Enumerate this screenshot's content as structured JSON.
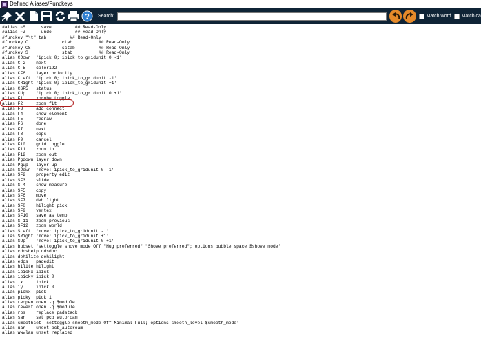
{
  "window": {
    "title": "Defined Aliases/Funckeys"
  },
  "toolbar": {
    "icons": [
      "pin-icon",
      "close-icon",
      "new-file-icon",
      "save-icon",
      "refresh-icon",
      "print-icon",
      "help-icon"
    ],
    "search_label": "Search:",
    "search_value": "",
    "match_word_label": "Match word",
    "match_case_label": "Match ca"
  },
  "colors": {
    "toolbar_bg": "#0f2436",
    "nav_btn": "#e58a2a",
    "highlight_ring": "#b01c1c"
  },
  "lines": [
    "#alias ~S      save         ## Read-Only",
    "#alias ~Z      undo         ## Read-Only",
    "#funckey \"\\t\" tab         ## Read-Only",
    "#funckey C             ctab          ## Read-Only",
    "#funckey CS            sctab         ## Read-Only",
    "#funckey S             stab          ## Read-Only",
    "alias CDown  'ipick 0; ipick_to_gridunit 0 -1'",
    "alias CF2    next",
    "alias CF5    color192",
    "alias CF6    layer priority",
    "alias CLeft  'ipick 0; ipick_to_gridunit -1'",
    "alias CRight 'ipick 0; ipick_to_gridunit +1'",
    "alias CSF5   status",
    "alias CUp    'ipick 0; ipick_to_gridunit 0 +1'",
    "alias F1     xprobe toggle",
    "alias F2     zoom fit",
    "alias F3     add connect",
    "alias F4     show element",
    "alias F5     redraw",
    "alias F6     done",
    "alias F7     next",
    "alias F8     oops",
    "alias F9     cancel",
    "alias F10    grid toggle",
    "alias F11    zoom in",
    "alias F12    zoom out",
    "alias Pgdown layer down",
    "alias Pgup   layer up",
    "alias SDown  'move; ipick_to_gridunit 0 -1'",
    "alias SF2    property edit",
    "alias SF3    slide",
    "alias SF4    show measure",
    "alias SF5    copy",
    "alias SF6    move",
    "alias SF7    dehilight",
    "alias SF8    hilight pick",
    "alias SF9    vertex",
    "alias SF10   save_as temp",
    "alias SF11   zoom previous",
    "alias SF12   zoom world",
    "alias SLeft  'move; ipick_to_gridunit -1'",
    "alias SRight 'move; ipick_to_gridunit +1'",
    "alias SUp    'move; ipick_to_gridunit 0 +1'",
    "alias bubset 'settoggle shove_mode Off \"Hug preferred\" \"Shove preferred\"; options bubble_space $shove_mode'",
    "alias cdnshelp cdsdoc",
    "alias dehilite dehilight",
    "alias edps   padedit",
    "alias hilite hilight",
    "alias ipickx ipick",
    "alias ipicky ipick 0",
    "alias ix     ipick",
    "alias iy     ipick 0",
    "alias pickx  pick",
    "alias picky  pick 1",
    "alias reopen open -q $module",
    "alias revert open -q $module",
    "alias rps    replace padstack",
    "alias sar    set pcb_autoroam",
    "alias smoothset 'settoggle smooth_mode Off Minimal Full; options smooth_level $smooth_mode'",
    "alias uar    unset pcb_autoroam",
    "alias wwwlan unset replaced"
  ]
}
